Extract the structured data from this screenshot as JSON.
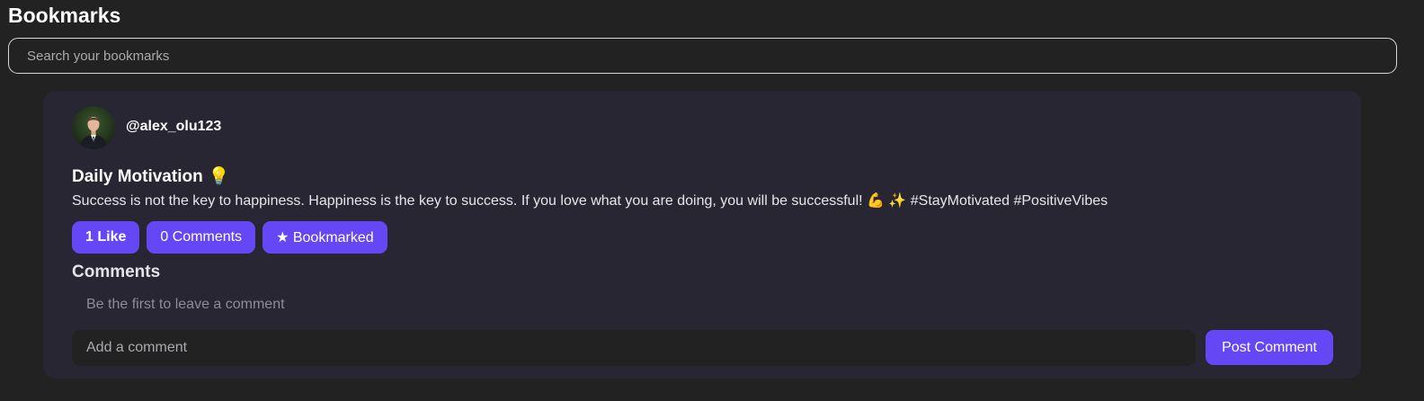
{
  "page": {
    "title": "Bookmarks"
  },
  "search": {
    "placeholder": "Search your bookmarks",
    "value": ""
  },
  "post": {
    "author": "@alex_olu123",
    "avatar_icon": "user-avatar-photo",
    "title": "Daily Motivation",
    "title_emoji": "💡",
    "body": "Success is not the key to happiness. Happiness is the key to success. If you love what you are doing, you will be successful! 💪 ✨ #StayMotivated #PositiveVibes",
    "actions": {
      "like_label": "1 Like",
      "comments_label": "0 Comments",
      "bookmark_label": "★ Bookmarked"
    },
    "comments": {
      "heading": "Comments",
      "empty_text": "Be the first to leave a comment",
      "input_placeholder": "Add a comment",
      "input_value": "",
      "submit_label": "Post Comment"
    }
  },
  "colors": {
    "background": "#222222",
    "card": "#282632",
    "accent": "#6647f5",
    "text": "#ffffff",
    "muted": "#8d8d96"
  }
}
